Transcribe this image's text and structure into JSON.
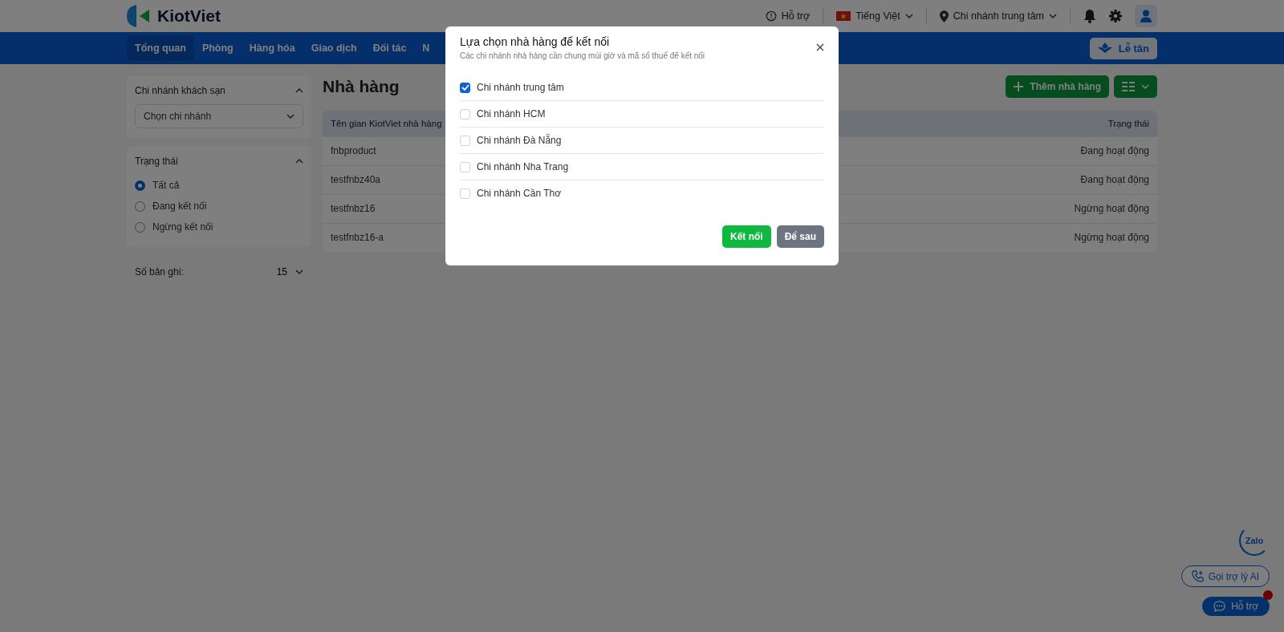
{
  "header": {
    "logo": "KiotViet",
    "support": "Hỗ trợ",
    "language": "Tiếng Việt",
    "branch": "Chi nhánh trung tâm"
  },
  "nav": {
    "tabs": [
      {
        "label": "Tổng quan",
        "selected": true
      },
      {
        "label": "Phòng",
        "selected": false
      },
      {
        "label": "Hàng hóa",
        "selected": false
      },
      {
        "label": "Giao dịch",
        "selected": false
      },
      {
        "label": "Đối tác",
        "selected": false
      },
      {
        "label": "N",
        "selected": false
      }
    ],
    "reception_button": "Lễ tân"
  },
  "sidebar": {
    "branch_filter": {
      "title": "Chi nhánh khách sạn",
      "placeholder": "Chọn chi nhánh"
    },
    "status_filter": {
      "title": "Trạng thái",
      "options": [
        {
          "label": "Tất cả",
          "selected": true
        },
        {
          "label": "Đang kết nối",
          "selected": false
        },
        {
          "label": "Ngừng kết nối",
          "selected": false
        }
      ]
    },
    "page_size": {
      "label": "Số bản ghi:",
      "value": "15"
    }
  },
  "main": {
    "title": "Nhà hàng",
    "add_button": "Thêm nhà hàng",
    "table": {
      "columns": [
        "Tên gian KiotViet nhà hàng",
        "Trạng thái"
      ],
      "rows": [
        {
          "name": "fnbproduct",
          "status": "Đang hoạt động"
        },
        {
          "name": "testfnbz40a",
          "status": "Đang hoạt động"
        },
        {
          "name": "testfnbz16",
          "status": "Ngừng hoạt động"
        },
        {
          "name": "testfnbz16-a",
          "status": "Ngừng hoạt động"
        }
      ]
    }
  },
  "modal": {
    "title": "Lựa chọn nhà hàng để kết nối",
    "subtitle": "Các chi nhánh nhà hàng cần chung múi giờ và mã số thuế để kết nối",
    "options": [
      {
        "label": "Chi nhánh trung tâm",
        "checked": true
      },
      {
        "label": "Chi nhánh HCM",
        "checked": false
      },
      {
        "label": "Chi nhánh Đà Nẵng",
        "checked": false
      },
      {
        "label": "Chi nhánh Nha Trang",
        "checked": false
      },
      {
        "label": "Chi nhánh Cần Thơ",
        "checked": false
      }
    ],
    "buttons": [
      "Kết nối",
      "Để sau"
    ]
  },
  "widgets": {
    "zalo": "Zalo",
    "ai_call": "Gọi trợ lý AI",
    "support": "Hỗ trợ"
  }
}
